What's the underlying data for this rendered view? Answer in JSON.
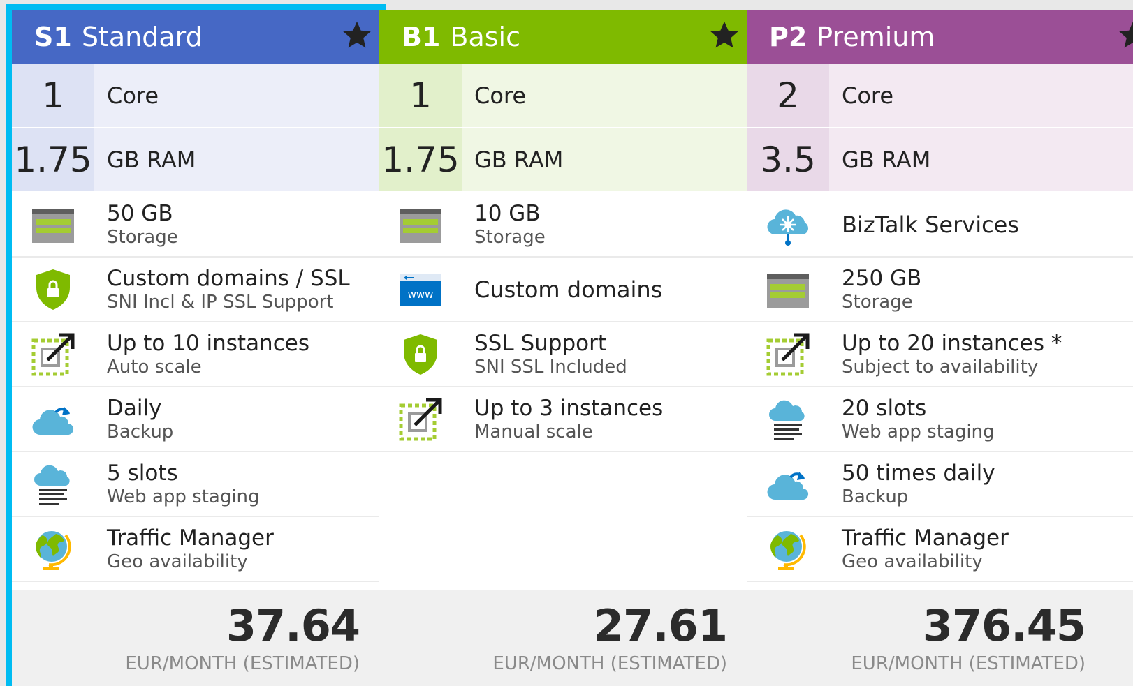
{
  "colors": {
    "selected_border": "#00bcf2",
    "standard": "#4668c5",
    "basic": "#7fba00",
    "premium": "#9b4f96",
    "storage_green": "#a4cc33",
    "shield_green": "#7fba00",
    "azure_blue": "#0072c6",
    "cloud_blue": "#59b4d9"
  },
  "tiers": [
    {
      "code": "S1",
      "name": "Standard",
      "star_icon": "star-icon",
      "core_value": "1",
      "core_label": "Core",
      "ram_value": "1.75",
      "ram_label": "GB RAM",
      "features": [
        {
          "icon": "storage-icon",
          "title": "50 GB",
          "subtitle": "Storage"
        },
        {
          "icon": "ssl-shield-icon",
          "title": "Custom domains / SSL",
          "subtitle": "SNI Incl & IP SSL Support"
        },
        {
          "icon": "scale-icon",
          "title": "Up to 10 instances",
          "subtitle": "Auto scale"
        },
        {
          "icon": "backup-cloud-icon",
          "title": "Daily",
          "subtitle": "Backup"
        },
        {
          "icon": "staging-cloud-icon",
          "title": "5 slots",
          "subtitle": "Web app staging"
        },
        {
          "icon": "globe-icon",
          "title": "Traffic Manager",
          "subtitle": "Geo availability"
        }
      ],
      "price": "37.64",
      "price_unit": "EUR/MONTH (ESTIMATED)"
    },
    {
      "code": "B1",
      "name": "Basic",
      "star_icon": "star-icon",
      "core_value": "1",
      "core_label": "Core",
      "ram_value": "1.75",
      "ram_label": "GB RAM",
      "features": [
        {
          "icon": "storage-icon",
          "title": "10 GB",
          "subtitle": "Storage"
        },
        {
          "icon": "www-icon",
          "title": "Custom domains",
          "subtitle": ""
        },
        {
          "icon": "ssl-shield-icon",
          "title": "SSL Support",
          "subtitle": "SNI SSL Included"
        },
        {
          "icon": "scale-icon",
          "title": "Up to 3 instances",
          "subtitle": "Manual scale"
        }
      ],
      "price": "27.61",
      "price_unit": "EUR/MONTH (ESTIMATED)"
    },
    {
      "code": "P2",
      "name": "Premium",
      "star_icon": "star-icon",
      "core_value": "2",
      "core_label": "Core",
      "ram_value": "3.5",
      "ram_label": "GB RAM",
      "features": [
        {
          "icon": "biztalk-icon",
          "title": "BizTalk Services",
          "subtitle": ""
        },
        {
          "icon": "storage-icon",
          "title": "250 GB",
          "subtitle": "Storage"
        },
        {
          "icon": "scale-icon",
          "title": "Up to 20 instances *",
          "subtitle": "Subject to availability"
        },
        {
          "icon": "staging-cloud-icon",
          "title": "20 slots",
          "subtitle": "Web app staging"
        },
        {
          "icon": "backup-cloud-icon",
          "title": "50 times daily",
          "subtitle": "Backup"
        },
        {
          "icon": "globe-icon",
          "title": "Traffic Manager",
          "subtitle": "Geo availability"
        }
      ],
      "price": "376.45",
      "price_unit": "EUR/MONTH (ESTIMATED)"
    }
  ]
}
